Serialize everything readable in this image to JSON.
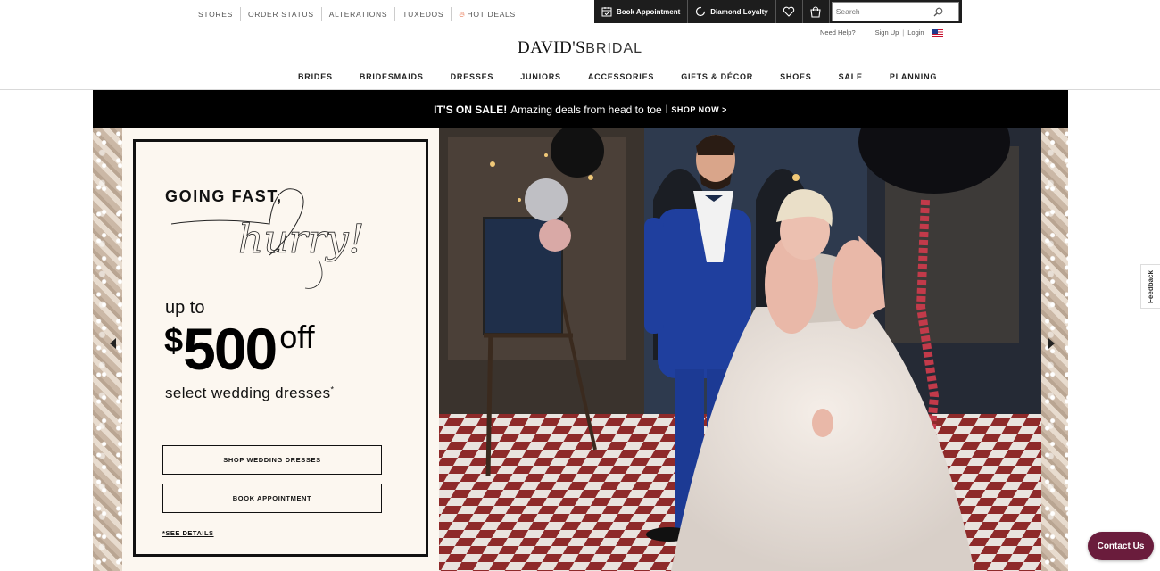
{
  "utility_links": [
    {
      "label": "STORES"
    },
    {
      "label": "ORDER STATUS"
    },
    {
      "label": "ALTERATIONS"
    },
    {
      "label": "TUXEDOS"
    },
    {
      "label": "HOT DEALS",
      "icon": "flame-icon"
    }
  ],
  "actions": {
    "book_appointment": "Book Appointment",
    "diamond_loyalty": "Diamond Loyalty",
    "wishlist_icon": "heart-icon",
    "bag_icon": "shopping-bag-icon",
    "search_placeholder": "Search",
    "search_icon": "magnifier-icon"
  },
  "account": {
    "help": "Need Help?",
    "signup": "Sign Up",
    "separator": "|",
    "login": "Login",
    "country_icon": "us-flag-icon"
  },
  "logo": {
    "brand": "DAVID'S",
    "suffix": "BRIDAL"
  },
  "main_nav": [
    "BRIDES",
    "BRIDESMAIDS",
    "DRESSES",
    "JUNIORS",
    "ACCESSORIES",
    "GIFTS & DÉCOR",
    "SHOES",
    "SALE",
    "PLANNING"
  ],
  "promo_bar": {
    "headline": "IT'S ON SALE!",
    "text": "Amazing deals from head to toe",
    "pipe": "|",
    "cta": "SHOP NOW >"
  },
  "hero": {
    "going_fast": "GOING FAST,",
    "script": "hurry!",
    "up_to": "up to",
    "currency": "$",
    "amount": "500",
    "off": "off",
    "select": "select wedding dresses",
    "asterisk": "*",
    "btn_shop": "SHOP WEDDING DRESSES",
    "btn_book": "BOOK APPOINTMENT",
    "details": "*SEE DETAILS"
  },
  "colors": {
    "top_bar": "#1d1d1d",
    "promo_bar": "#000000",
    "card_bg": "#fcf7f0",
    "contact_button": "#6a1c3c",
    "hot_deals_flame": "#e2572b"
  },
  "feedback": "Feedback",
  "contact": "Contact Us"
}
